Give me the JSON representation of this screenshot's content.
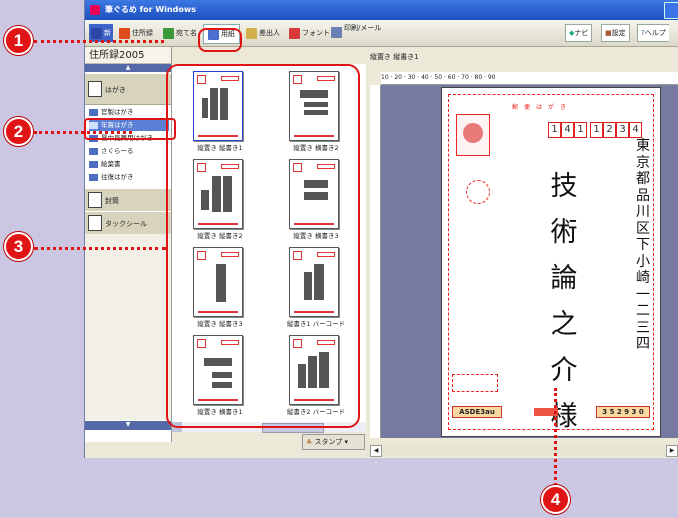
{
  "window": {
    "title": "筆ぐるめ for Windows"
  },
  "toolbar": {
    "items": [
      {
        "label": "新",
        "icon": "new-icon"
      },
      {
        "label": "住所録",
        "icon": "address-book-icon"
      },
      {
        "label": "宛て名",
        "icon": "address-icon"
      },
      {
        "label": "用紙",
        "icon": "paper-icon"
      },
      {
        "label": "差出人",
        "icon": "sender-icon"
      },
      {
        "label": "フォント",
        "icon": "font-icon"
      },
      {
        "label": "印刷/メール",
        "icon": "print-mail-icon"
      }
    ],
    "right_items": [
      {
        "label": "ナビ",
        "icon": "navi-icon"
      },
      {
        "label": "設定",
        "icon": "settings-icon"
      },
      {
        "label": "ヘルプ",
        "icon": "help-icon"
      }
    ]
  },
  "left_pane": {
    "title": "住所録2005",
    "categories": {
      "hagaki": "はがき",
      "envelope": "封筒",
      "tack_seal": "タックシール"
    },
    "subitems": [
      {
        "label": "官製はがき",
        "selected": false
      },
      {
        "label": "年賀はがき",
        "selected": true
      },
      {
        "label": "暑中見舞用はがき",
        "selected": false
      },
      {
        "label": "さくらーる",
        "selected": false
      },
      {
        "label": "絵葉書",
        "selected": false
      },
      {
        "label": "往復はがき",
        "selected": false
      }
    ]
  },
  "layouts": [
    {
      "label": "縦置き 縦書き1",
      "selected": true
    },
    {
      "label": "縦置き 横書き2",
      "selected": false
    },
    {
      "label": "縦置き 縦書き2",
      "selected": false
    },
    {
      "label": "縦置き 横書き3",
      "selected": false
    },
    {
      "label": "縦置き 縦書き3",
      "selected": false
    },
    {
      "label": "縦書き1 バーコード",
      "selected": false
    },
    {
      "label": "縦置き 横書き1",
      "selected": false
    },
    {
      "label": "縦書き2 バーコード",
      "selected": false
    }
  ],
  "stamp_button": "スタンプ",
  "preview": {
    "tab": "縦置き 縦書き1",
    "ruler": "10 · 20 · 30 · 40 · 50 · 60 · 70 · 80 · 90",
    "zip_digits": [
      "1",
      "4",
      "1",
      "1",
      "2",
      "3",
      "4"
    ],
    "zip_guide": "郵便はがき",
    "address_chars": [
      "東",
      "京",
      "都",
      "品",
      "川",
      "区",
      "下",
      "小",
      "崎",
      "一",
      "二",
      "三",
      "四"
    ],
    "name_chars": [
      "技",
      "術",
      "論",
      "之",
      "介",
      "様"
    ],
    "sender_zip": "3 5 2 9 3 0",
    "footer_tag": "ASDE3au"
  },
  "callouts": [
    "1",
    "2",
    "3",
    "4"
  ],
  "colors": {
    "accent": "#e01414",
    "selection": "#5a7fd4",
    "titlebar": "#1c4fbf"
  }
}
